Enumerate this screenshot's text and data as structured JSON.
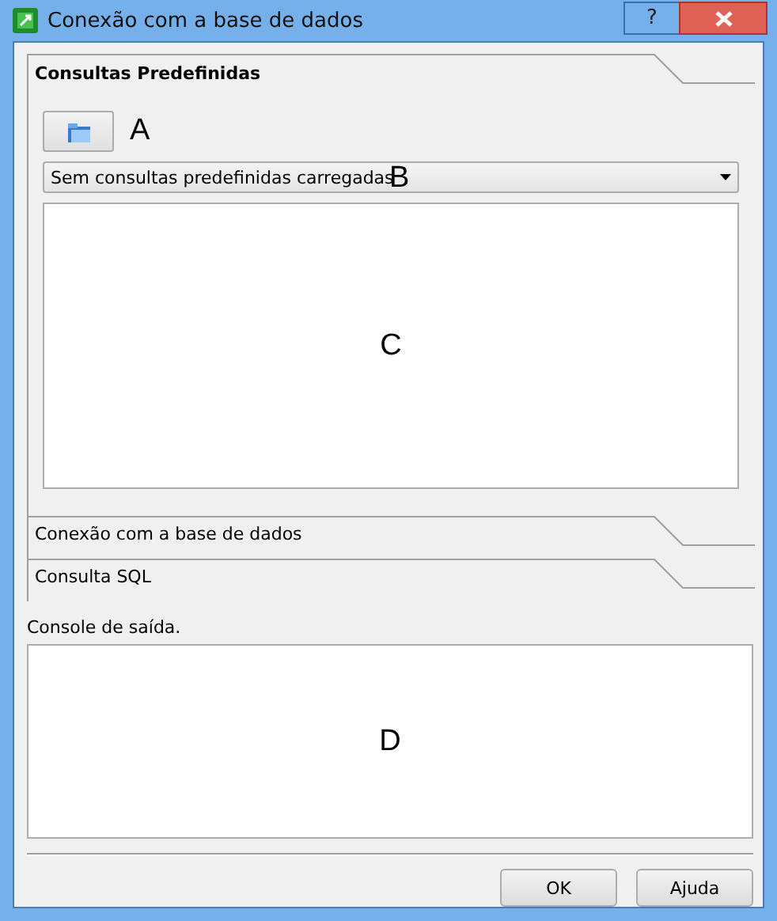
{
  "window": {
    "title": "Conexão com a base de dados",
    "help_button": "?"
  },
  "sections": [
    {
      "title": "Consultas Predefinidas",
      "expanded": true,
      "load_button_annotation": "A",
      "combo": {
        "value": "Sem consultas predefinidas carregadas",
        "annotation": "B"
      },
      "text_area": {
        "annotation": "C"
      }
    },
    {
      "title": "Conexão com a base de dados",
      "expanded": false
    },
    {
      "title": "Consulta SQL",
      "expanded": false
    }
  ],
  "output": {
    "label": "Console de saída.",
    "annotation": "D"
  },
  "buttons": [
    "OK",
    "Ajuda"
  ]
}
